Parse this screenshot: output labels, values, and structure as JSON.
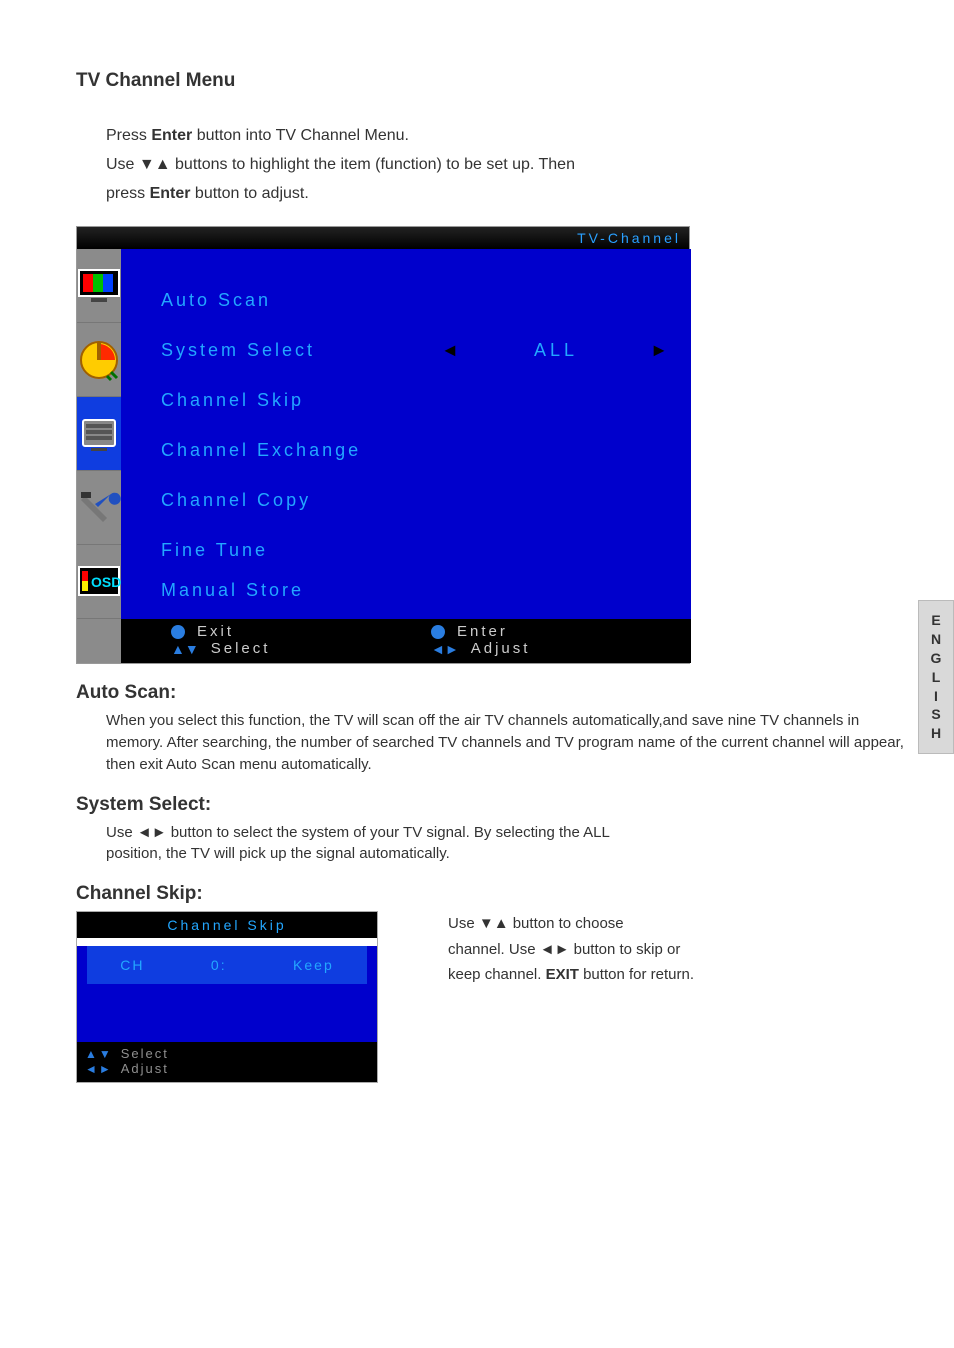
{
  "headings": {
    "page_title": "TV Channel Menu",
    "auto_scan": "Auto Scan:",
    "system_select": "System Select:",
    "channel_skip": "Channel Skip:"
  },
  "intro": {
    "press": "Press ",
    "enter": "Enter",
    "line1_tail": " button into TV Channel Menu.",
    "use": "Use ",
    "arrows_ud": "▼▲",
    "line2_tail": " buttons to highlight the item (function) to be set up. Then",
    "press2": "press ",
    "line3_tail": " button to adjust."
  },
  "osd": {
    "header_title": "TV-Channel",
    "items": [
      {
        "label": "Auto Scan"
      },
      {
        "label": "System Select",
        "value": "ALL",
        "has_value": true
      },
      {
        "label": "Channel Skip"
      },
      {
        "label": "Channel Exchange"
      },
      {
        "label": "Channel Copy"
      },
      {
        "label": "Fine Tune"
      },
      {
        "label": "Manual Store"
      }
    ],
    "footer": {
      "exit": "Exit",
      "enter": "Enter",
      "select": "Select",
      "adjust": "Adjust"
    }
  },
  "auto_scan_para": "When you select this function, the TV will scan off the air TV channels automatically,and save nine TV channels in memory. After searching, the number of searched TV channels and TV program name of the current channel will appear, then exit Auto Scan menu automatically.",
  "system_select": {
    "line1_a": "Use ",
    "arrows_lr": "◄►",
    "line1_b": " button to select the system of your TV signal. By selecting the ALL",
    "line2": "position, the TV will pick up the signal automatically."
  },
  "channel_skip": {
    "osd_title": "Channel Skip",
    "row": {
      "ch": "CH",
      "num": "0:",
      "status": "Keep"
    },
    "foot_select": "Select",
    "foot_adjust": "Adjust",
    "right": {
      "a": "Use ",
      "ud": "▼▲",
      "b": " button to choose",
      "c": "channel. Use ",
      "lr": "◄►",
      "d": " button to skip or",
      "e": "keep channel. ",
      "exit": "EXIT",
      "f": " button for return."
    }
  },
  "side_tab": [
    "E",
    "N",
    "G",
    "L",
    "I",
    "S",
    "H"
  ]
}
